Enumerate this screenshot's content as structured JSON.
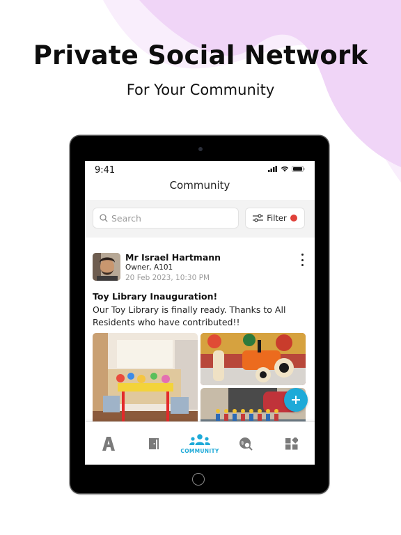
{
  "banner": {
    "headline": "Private Social Network",
    "subheadline": "For Your Community",
    "accent_color": "#f0d5f7"
  },
  "status_bar": {
    "time": "9:41"
  },
  "header": {
    "title": "Community"
  },
  "toolbar": {
    "search_placeholder": "Search",
    "filter_label": "Filter",
    "filter_indicator_color": "#e0413a"
  },
  "post": {
    "author": "Mr Israel Hartmann",
    "role": "Owner, A101",
    "timestamp": "20 Feb 2023, 10:30 PM",
    "title": "Toy Library Inauguration!",
    "body": "Our Toy Library is finally ready. Thanks to All Residents who have contributed!!",
    "photos": [
      "toy-library-room",
      "wooden-toy-car",
      "lego-figures"
    ]
  },
  "fab": {
    "icon": "plus-icon",
    "color": "#1eaad8"
  },
  "tabbar": {
    "active_color": "#1eaad8",
    "inactive_color": "#7a7a7a",
    "tabs": [
      {
        "icon": "app-logo-a-icon",
        "label": ""
      },
      {
        "icon": "door-icon",
        "label": ""
      },
      {
        "icon": "community-people-icon",
        "label": "COMMUNITY",
        "active": true
      },
      {
        "icon": "globe-search-icon",
        "label": ""
      },
      {
        "icon": "widgets-icon",
        "label": ""
      }
    ]
  }
}
